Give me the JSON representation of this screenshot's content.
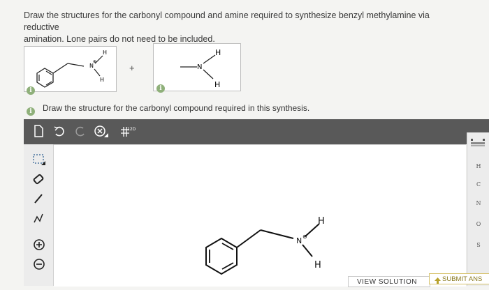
{
  "question": {
    "line1": "Draw the structures for the carbonyl compound and amine required to synthesize benzyl methylamine via reductive",
    "line2": "amination. Lone pairs do not need to be included."
  },
  "scheme": {
    "product_atoms": {
      "n": "N",
      "charge": "⊕",
      "h_top": "H",
      "h_bottom": "H"
    },
    "plus": "+",
    "amine_atoms": {
      "n": "N",
      "h_top": "H",
      "h_bottom": "H"
    }
  },
  "info_glyph": "i",
  "subquestion": "Draw the structure for the carbonyl compound required in this synthesis.",
  "toolbar": {
    "icons": [
      "new-document-icon",
      "undo-icon",
      "redo-icon",
      "delete-icon",
      "template-icon"
    ],
    "template_label": "12D"
  },
  "left_tools": [
    "select-icon",
    "eraser-icon",
    "single-bond-icon",
    "chain-icon",
    "add-charge-icon",
    "remove-charge-icon"
  ],
  "elements": [
    "H",
    "C",
    "N",
    "O",
    "S"
  ],
  "canvas_molecule": {
    "n": "N",
    "charge": "⊕",
    "h_top": "H",
    "h_bottom": "H"
  },
  "buttons": {
    "view_solution": "VIEW SOLUTION",
    "submit": "SUBMIT ANS"
  },
  "colors": {
    "toolbar": "#595959",
    "info": "#8fb07a",
    "submit_accent": "#d6c26a"
  }
}
